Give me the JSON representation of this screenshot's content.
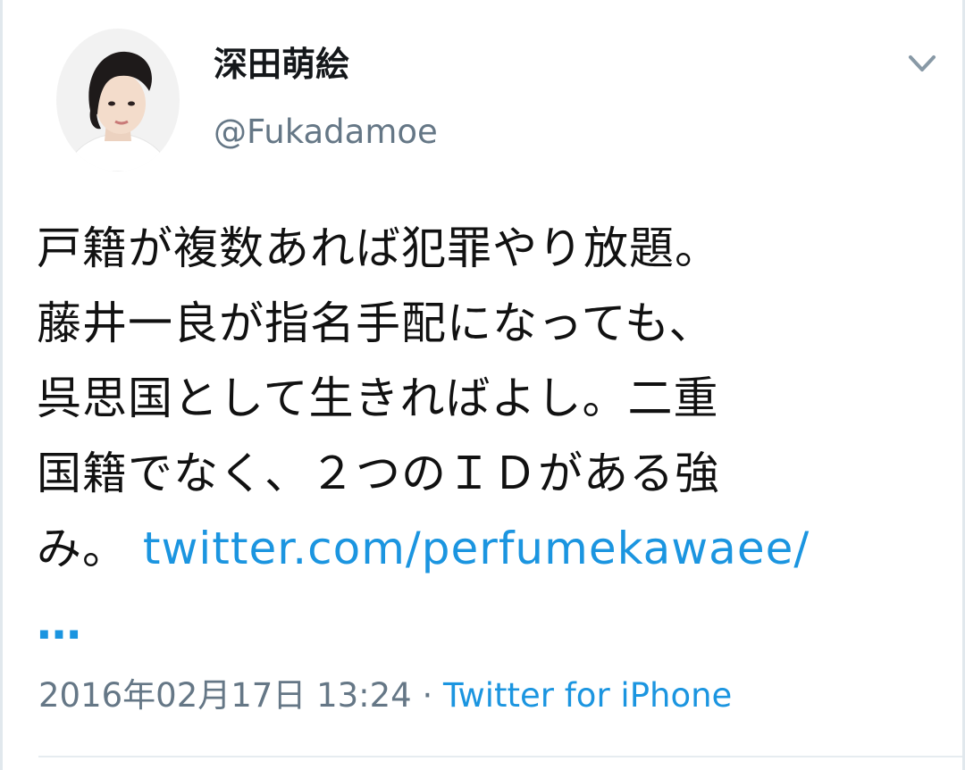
{
  "author": {
    "display_name": "深田萌絵",
    "handle": "@Fukadamoe"
  },
  "tweet": {
    "lines": [
      "戸籍が複数あれば犯罪やり放題。",
      "藤井一良が指名手配になっても、",
      "呉思国として生きればよし。二重",
      "国籍でなく、２つのＩＤがある強"
    ],
    "last_line_prefix": "み。",
    "link_text": "twitter.com/perfumekawaee/",
    "link_ellipsis": "…"
  },
  "meta": {
    "timestamp": "2016年02月17日 13:24",
    "separator": " · ",
    "source": "Twitter for iPhone"
  },
  "icons": {
    "menu": "chevron-down-icon",
    "avatar": "profile-photo"
  },
  "colors": {
    "link": "#1b95e0",
    "secondary_text": "#657786",
    "primary_text": "#14171a",
    "divider": "#e6ecf0"
  }
}
